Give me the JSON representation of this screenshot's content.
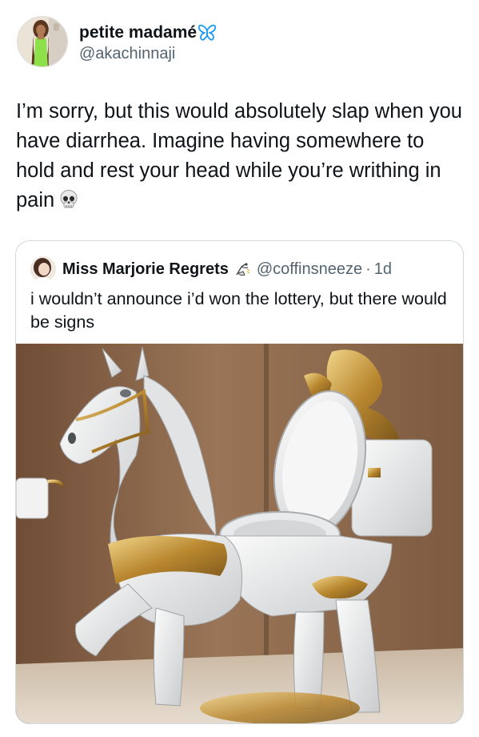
{
  "tweet": {
    "display_name": "petite madamé",
    "handle": "@akachinnaji",
    "text": "I’m sorry, but this would absolutely slap when you have diarrhea. Imagine having somewhere to hold and rest your head while you’re writhing in pain",
    "emoji": "skull-emoji",
    "badge_emoji": "butterfly-emoji"
  },
  "quote": {
    "display_name": "Miss Marjorie Regrets",
    "badge_emoji": "sneeze-bird-emoji",
    "handle": "@coffinsneeze",
    "separator": "·",
    "time": "1d",
    "text": "i wouldn’t announce i’d won the lottery, but there would be signs",
    "image": "horse-shaped-toilet-photo"
  },
  "colors": {
    "text_primary": "#0f1419",
    "text_secondary": "#536471",
    "border": "#cfd9de",
    "butterfly": "#1d9bf0"
  }
}
